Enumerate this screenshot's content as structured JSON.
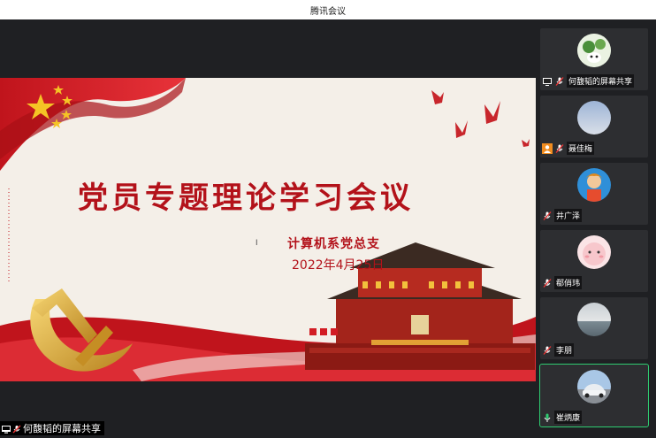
{
  "window": {
    "title": "腾讯会议"
  },
  "slide": {
    "title": "党员专题理论学习会议",
    "organization": "计算机系党总支",
    "date": "2022年4月25日"
  },
  "share": {
    "label": "何馥韬的屏幕共享"
  },
  "participants": [
    {
      "name": "何馥韬的屏幕共享",
      "badge": "screen-share-icon",
      "mic": "mic-muted-icon",
      "active": false
    },
    {
      "name": "聂佳梅",
      "badge": "host-user-icon",
      "mic": "mic-muted-icon",
      "active": false
    },
    {
      "name": "井广泽",
      "badge": "",
      "mic": "mic-muted-icon",
      "active": false
    },
    {
      "name": "郗俏玮",
      "badge": "",
      "mic": "mic-muted-icon",
      "active": false
    },
    {
      "name": "李朋",
      "badge": "",
      "mic": "mic-muted-icon",
      "active": false
    },
    {
      "name": "崔炳康",
      "badge": "",
      "mic": "mic-on-icon",
      "active": true
    }
  ],
  "colors": {
    "accent_red": "#b3121a",
    "active_green": "#2ecc71",
    "host_orange": "#f08c1f"
  }
}
